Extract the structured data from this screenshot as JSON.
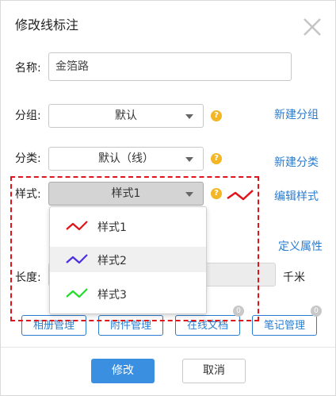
{
  "dialog": {
    "title": "修改线标注"
  },
  "fields": {
    "name_label": "名称:",
    "name_value": "金箔路",
    "group_label": "分组:",
    "group_value": "默认",
    "category_label": "分类:",
    "category_value": "默认（线）",
    "style_label": "样式:",
    "style_value": "样式1",
    "length_label": "长度:",
    "length_unit": "千米"
  },
  "help_glyph": "?",
  "links": {
    "new_group": "新建分组",
    "new_category": "新建分类",
    "edit_style": "编辑样式",
    "define_attrs": "定义属性"
  },
  "style_preview_color": "#e0141b",
  "dropdown": {
    "options": [
      {
        "label": "样式1",
        "color": "#e0141b"
      },
      {
        "label": "样式2",
        "color": "#4a2ee0"
      },
      {
        "label": "样式3",
        "color": "#22dd2a"
      }
    ]
  },
  "tabs": [
    {
      "label": "相册管理",
      "badge": ""
    },
    {
      "label": "附件管理",
      "badge": ""
    },
    {
      "label": "在线文档",
      "badge": "0"
    },
    {
      "label": "笔记管理",
      "badge": "0"
    }
  ],
  "buttons": {
    "confirm": "修改",
    "cancel": "取消"
  }
}
